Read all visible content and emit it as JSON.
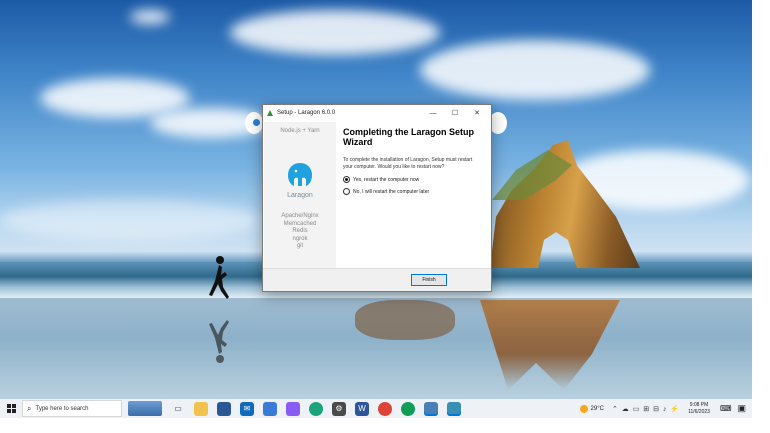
{
  "dialog": {
    "window_title": "Setup - Laragon 6.0.0",
    "minimize": "—",
    "maximize": "☐",
    "close": "✕",
    "sidebar_top": "Node.js + Yarn",
    "brand": "Laragon",
    "stack": [
      "Apache/Nginx",
      "Memcached",
      "Redis",
      "ngrok",
      "git"
    ],
    "heading": "Completing the Laragon Setup Wizard",
    "description": "To complete the installation of Laragon, Setup must restart your computer. Would you like to restart now?",
    "options": [
      {
        "label": "Yes, restart the computer now",
        "selected": true
      },
      {
        "label": "No, I will restart the computer later",
        "selected": false
      }
    ],
    "finish_label": "Finish",
    "accent": "#0078d7"
  },
  "taskbar": {
    "search_placeholder": "Type here to search",
    "weather": "29°C",
    "time": "9:08 PM",
    "date": "11/6/2023",
    "apps": [
      "file-explorer",
      "store",
      "mail",
      "photos",
      "settings",
      "edge",
      "chrome",
      "word",
      "chrome-alt",
      "chrome-profile",
      "app",
      "app-active"
    ]
  }
}
